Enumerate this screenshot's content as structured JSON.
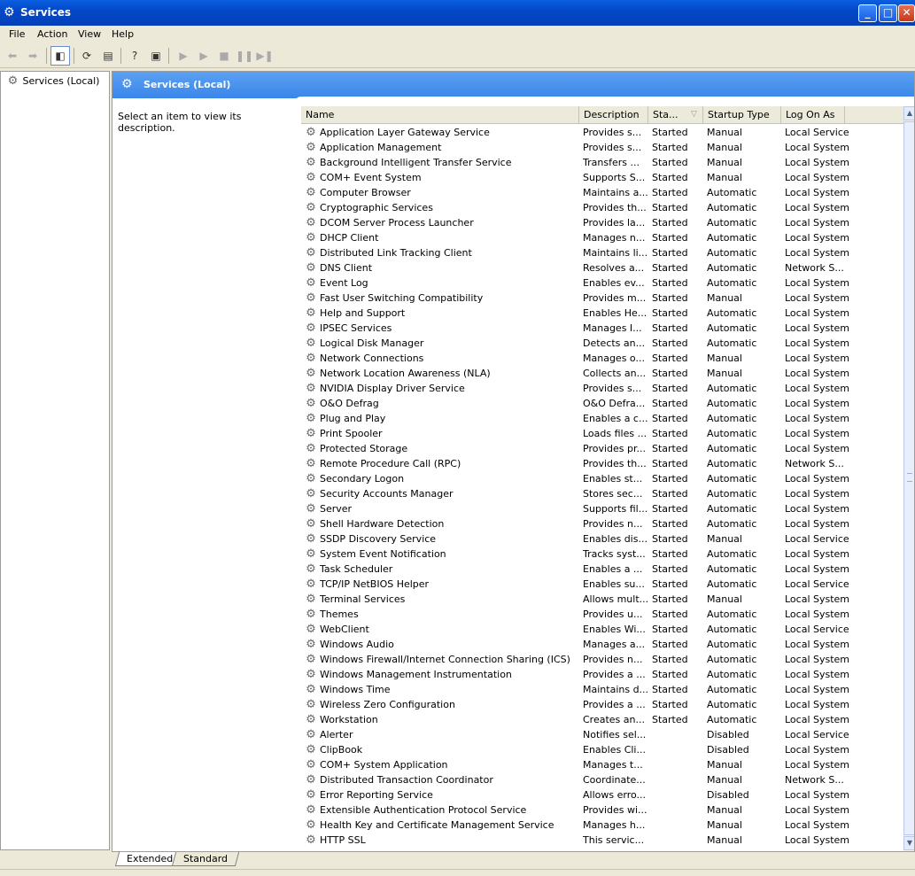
{
  "window": {
    "title": "Services"
  },
  "menu": [
    "File",
    "Action",
    "View",
    "Help"
  ],
  "tree": {
    "root_label": "Services (Local)"
  },
  "banner": {
    "title": "Services (Local)"
  },
  "description_prompt": "Select an item to view its description.",
  "columns": {
    "name": "Name",
    "description": "Description",
    "status": "Sta...",
    "startup": "Startup Type",
    "logon": "Log On As"
  },
  "tabs": {
    "extended": "Extended",
    "standard": "Standard"
  },
  "toolbar_icons": [
    "back-icon",
    "forward-icon",
    "show-hide-tree-icon",
    "refresh-icon",
    "export-list-icon",
    "help-icon",
    "properties-icon",
    "start-service-icon",
    "start-service-alt-icon",
    "stop-service-icon",
    "pause-service-icon",
    "restart-service-icon"
  ],
  "services": [
    {
      "name": "Application Layer Gateway Service",
      "description": "Provides s...",
      "status": "Started",
      "startup": "Manual",
      "logon": "Local Service"
    },
    {
      "name": "Application Management",
      "description": "Provides s...",
      "status": "Started",
      "startup": "Manual",
      "logon": "Local System"
    },
    {
      "name": "Background Intelligent Transfer Service",
      "description": "Transfers ...",
      "status": "Started",
      "startup": "Manual",
      "logon": "Local System"
    },
    {
      "name": "COM+ Event System",
      "description": "Supports S...",
      "status": "Started",
      "startup": "Manual",
      "logon": "Local System"
    },
    {
      "name": "Computer Browser",
      "description": "Maintains a...",
      "status": "Started",
      "startup": "Automatic",
      "logon": "Local System"
    },
    {
      "name": "Cryptographic Services",
      "description": "Provides th...",
      "status": "Started",
      "startup": "Automatic",
      "logon": "Local System"
    },
    {
      "name": "DCOM Server Process Launcher",
      "description": "Provides la...",
      "status": "Started",
      "startup": "Automatic",
      "logon": "Local System"
    },
    {
      "name": "DHCP Client",
      "description": "Manages n...",
      "status": "Started",
      "startup": "Automatic",
      "logon": "Local System"
    },
    {
      "name": "Distributed Link Tracking Client",
      "description": "Maintains li...",
      "status": "Started",
      "startup": "Automatic",
      "logon": "Local System"
    },
    {
      "name": "DNS Client",
      "description": "Resolves a...",
      "status": "Started",
      "startup": "Automatic",
      "logon": "Network S..."
    },
    {
      "name": "Event Log",
      "description": "Enables ev...",
      "status": "Started",
      "startup": "Automatic",
      "logon": "Local System"
    },
    {
      "name": "Fast User Switching Compatibility",
      "description": "Provides m...",
      "status": "Started",
      "startup": "Manual",
      "logon": "Local System"
    },
    {
      "name": "Help and Support",
      "description": "Enables He...",
      "status": "Started",
      "startup": "Automatic",
      "logon": "Local System"
    },
    {
      "name": "IPSEC Services",
      "description": "Manages I...",
      "status": "Started",
      "startup": "Automatic",
      "logon": "Local System"
    },
    {
      "name": "Logical Disk Manager",
      "description": "Detects an...",
      "status": "Started",
      "startup": "Automatic",
      "logon": "Local System"
    },
    {
      "name": "Network Connections",
      "description": "Manages o...",
      "status": "Started",
      "startup": "Manual",
      "logon": "Local System"
    },
    {
      "name": "Network Location Awareness (NLA)",
      "description": "Collects an...",
      "status": "Started",
      "startup": "Manual",
      "logon": "Local System"
    },
    {
      "name": "NVIDIA Display Driver Service",
      "description": "Provides s...",
      "status": "Started",
      "startup": "Automatic",
      "logon": "Local System"
    },
    {
      "name": "O&O Defrag",
      "description": "O&O Defra...",
      "status": "Started",
      "startup": "Automatic",
      "logon": "Local System"
    },
    {
      "name": "Plug and Play",
      "description": "Enables a c...",
      "status": "Started",
      "startup": "Automatic",
      "logon": "Local System"
    },
    {
      "name": "Print Spooler",
      "description": "Loads files ...",
      "status": "Started",
      "startup": "Automatic",
      "logon": "Local System"
    },
    {
      "name": "Protected Storage",
      "description": "Provides pr...",
      "status": "Started",
      "startup": "Automatic",
      "logon": "Local System"
    },
    {
      "name": "Remote Procedure Call (RPC)",
      "description": "Provides th...",
      "status": "Started",
      "startup": "Automatic",
      "logon": "Network S..."
    },
    {
      "name": "Secondary Logon",
      "description": "Enables st...",
      "status": "Started",
      "startup": "Automatic",
      "logon": "Local System"
    },
    {
      "name": "Security Accounts Manager",
      "description": "Stores sec...",
      "status": "Started",
      "startup": "Automatic",
      "logon": "Local System"
    },
    {
      "name": "Server",
      "description": "Supports fil...",
      "status": "Started",
      "startup": "Automatic",
      "logon": "Local System"
    },
    {
      "name": "Shell Hardware Detection",
      "description": "Provides n...",
      "status": "Started",
      "startup": "Automatic",
      "logon": "Local System"
    },
    {
      "name": "SSDP Discovery Service",
      "description": "Enables dis...",
      "status": "Started",
      "startup": "Manual",
      "logon": "Local Service"
    },
    {
      "name": "System Event Notification",
      "description": "Tracks syst...",
      "status": "Started",
      "startup": "Automatic",
      "logon": "Local System"
    },
    {
      "name": "Task Scheduler",
      "description": "Enables a ...",
      "status": "Started",
      "startup": "Automatic",
      "logon": "Local System"
    },
    {
      "name": "TCP/IP NetBIOS Helper",
      "description": "Enables su...",
      "status": "Started",
      "startup": "Automatic",
      "logon": "Local Service"
    },
    {
      "name": "Terminal Services",
      "description": "Allows mult...",
      "status": "Started",
      "startup": "Manual",
      "logon": "Local System"
    },
    {
      "name": "Themes",
      "description": "Provides u...",
      "status": "Started",
      "startup": "Automatic",
      "logon": "Local System"
    },
    {
      "name": "WebClient",
      "description": "Enables Wi...",
      "status": "Started",
      "startup": "Automatic",
      "logon": "Local Service"
    },
    {
      "name": "Windows Audio",
      "description": "Manages a...",
      "status": "Started",
      "startup": "Automatic",
      "logon": "Local System"
    },
    {
      "name": "Windows Firewall/Internet Connection Sharing (ICS)",
      "description": "Provides n...",
      "status": "Started",
      "startup": "Automatic",
      "logon": "Local System"
    },
    {
      "name": "Windows Management Instrumentation",
      "description": "Provides a ...",
      "status": "Started",
      "startup": "Automatic",
      "logon": "Local System"
    },
    {
      "name": "Windows Time",
      "description": "Maintains d...",
      "status": "Started",
      "startup": "Automatic",
      "logon": "Local System"
    },
    {
      "name": "Wireless Zero Configuration",
      "description": "Provides a ...",
      "status": "Started",
      "startup": "Automatic",
      "logon": "Local System"
    },
    {
      "name": "Workstation",
      "description": "Creates an...",
      "status": "Started",
      "startup": "Automatic",
      "logon": "Local System"
    },
    {
      "name": "Alerter",
      "description": "Notifies sel...",
      "status": "",
      "startup": "Disabled",
      "logon": "Local Service"
    },
    {
      "name": "ClipBook",
      "description": "Enables Cli...",
      "status": "",
      "startup": "Disabled",
      "logon": "Local System"
    },
    {
      "name": "COM+ System Application",
      "description": "Manages t...",
      "status": "",
      "startup": "Manual",
      "logon": "Local System"
    },
    {
      "name": "Distributed Transaction Coordinator",
      "description": "Coordinate...",
      "status": "",
      "startup": "Manual",
      "logon": "Network S..."
    },
    {
      "name": "Error Reporting Service",
      "description": "Allows erro...",
      "status": "",
      "startup": "Disabled",
      "logon": "Local System"
    },
    {
      "name": "Extensible Authentication Protocol Service",
      "description": "Provides wi...",
      "status": "",
      "startup": "Manual",
      "logon": "Local System"
    },
    {
      "name": "Health Key and Certificate Management Service",
      "description": "Manages h...",
      "status": "",
      "startup": "Manual",
      "logon": "Local System"
    },
    {
      "name": "HTTP SSL",
      "description": "This servic...",
      "status": "",
      "startup": "Manual",
      "logon": "Local System"
    }
  ]
}
